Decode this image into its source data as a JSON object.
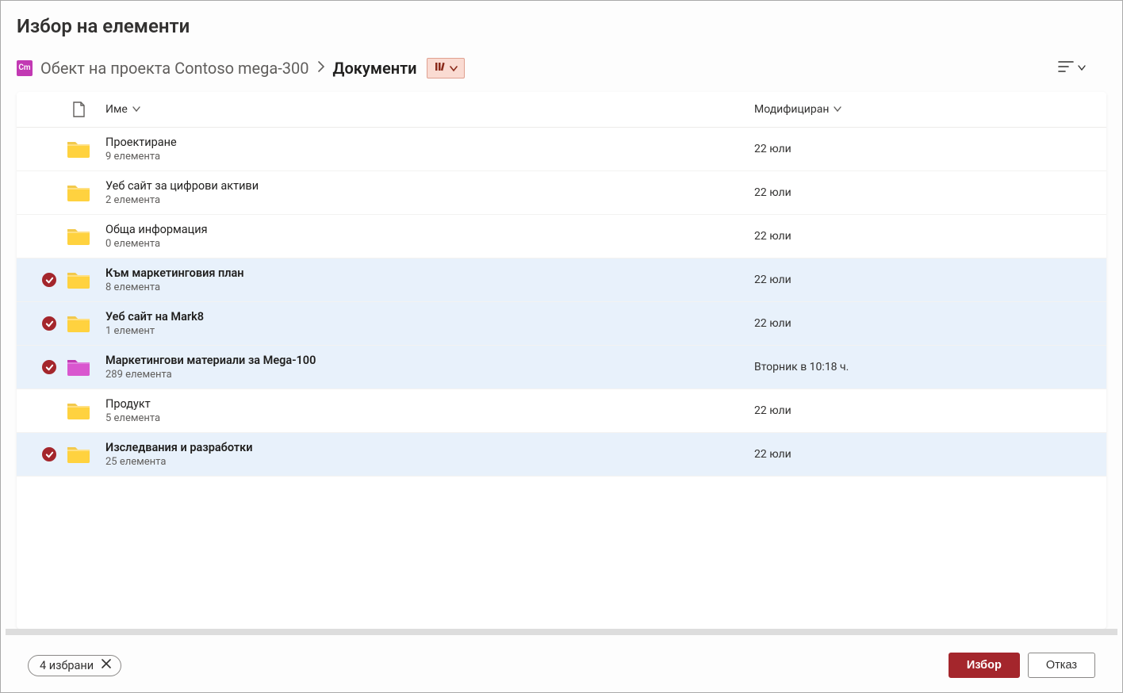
{
  "title": "Избор на елементи",
  "breadcrumb": {
    "root_label": "Обект на проекта Contoso mega-300",
    "current_label": "Документи",
    "root_icon_letters": "Cm"
  },
  "columns": {
    "name": "Име",
    "modified": "Модифициран"
  },
  "rows": [
    {
      "name": "Проектиране",
      "subtitle": "9 елемента",
      "modified": "22 юли",
      "selected": false,
      "folderColor": "yellow"
    },
    {
      "name": "Уеб сайт за цифрови активи",
      "subtitle": "2 елемента",
      "modified": "22 юли",
      "selected": false,
      "folderColor": "yellow"
    },
    {
      "name": "Обща информация",
      "subtitle": "0 елемента",
      "modified": "22 юли",
      "selected": false,
      "folderColor": "yellow"
    },
    {
      "name": "Към маркетинговия план",
      "subtitle": "8 елемента",
      "modified": "22 юли",
      "selected": true,
      "folderColor": "yellow"
    },
    {
      "name": "Уеб сайт на Mark8",
      "subtitle": "1 елемент",
      "modified": "22 юли",
      "selected": true,
      "folderColor": "yellow"
    },
    {
      "name": "Маркетингови материали за Mega-100",
      "subtitle": "289 елемента",
      "modified": "Вторник в 10:18 ч.",
      "selected": true,
      "folderColor": "magenta"
    },
    {
      "name": "Продукт",
      "subtitle": "5 елемента",
      "modified": "22 юли",
      "selected": false,
      "folderColor": "yellow"
    },
    {
      "name": "Изследвания и разработки",
      "subtitle": "25 елемента",
      "modified": "22 юли",
      "selected": true,
      "folderColor": "yellow"
    }
  ],
  "footer": {
    "selection_text": "4 избрани",
    "primary_button": "Избор",
    "secondary_button": "Отказ"
  }
}
